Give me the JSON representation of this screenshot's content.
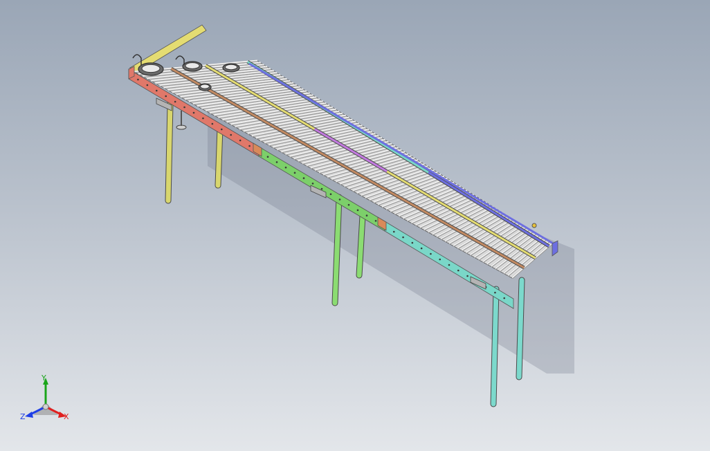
{
  "viewport": {
    "background_top": "#9aa6b6",
    "background_bottom": "#e3e6ea"
  },
  "model": {
    "type": "roller-conveyor-assembly",
    "lanes": 3,
    "leg_pairs": 3,
    "colors": {
      "frame_red": "#e0786a",
      "frame_green": "#7ccf6a",
      "frame_teal": "#7ad7c8",
      "leg_yellow": "#d8d66e",
      "leg_green": "#8bdc72",
      "leg_teal": "#7cd9cc",
      "rail_yellow": "#e4dc72",
      "rail_purple": "#c27adf",
      "rail_blue": "#6d6fe0",
      "rail_brown": "#c28a62",
      "roller": "#f2f2f2",
      "roller_edge": "#9a9a9a",
      "bracket": "#b4b4b4"
    }
  },
  "triad": {
    "y_label": "Y",
    "x_label": "X",
    "z_label": "Z",
    "y_color": "#1aa51a",
    "x_color": "#e02020",
    "z_color": "#1f3fe6"
  }
}
